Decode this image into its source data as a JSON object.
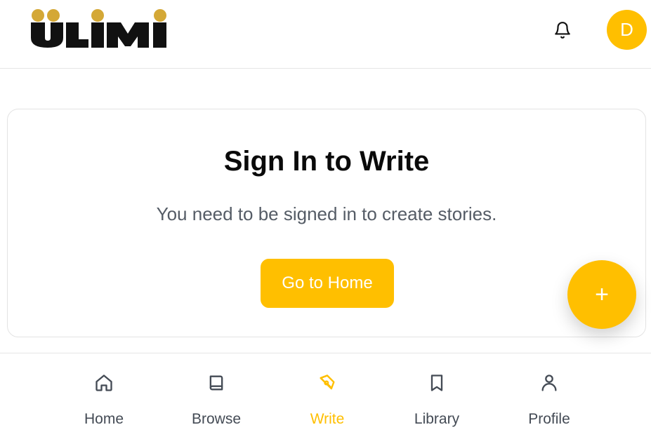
{
  "header": {
    "logo_text": "ULIMI",
    "avatar_initial": "D",
    "bell_icon": "bell-icon"
  },
  "colors": {
    "accent": "#ffbf00",
    "text_dark": "#0a0a0a",
    "text_muted": "#555c66",
    "nav_text": "#444b55",
    "logo_black": "#111111",
    "logo_gold": "#d4a836"
  },
  "card": {
    "title": "Sign In to Write",
    "message": "You need to be signed in to create stories.",
    "button_label": "Go to Home"
  },
  "fab": {
    "label": "+",
    "icon": "plus-icon"
  },
  "nav": {
    "items": [
      {
        "label": "Home",
        "icon": "home-icon",
        "active": false
      },
      {
        "label": "Browse",
        "icon": "book-icon",
        "active": false
      },
      {
        "label": "Write",
        "icon": "pen-tool-icon",
        "active": true
      },
      {
        "label": "Library",
        "icon": "bookmark-icon",
        "active": false
      },
      {
        "label": "Profile",
        "icon": "user-icon",
        "active": false
      }
    ]
  }
}
